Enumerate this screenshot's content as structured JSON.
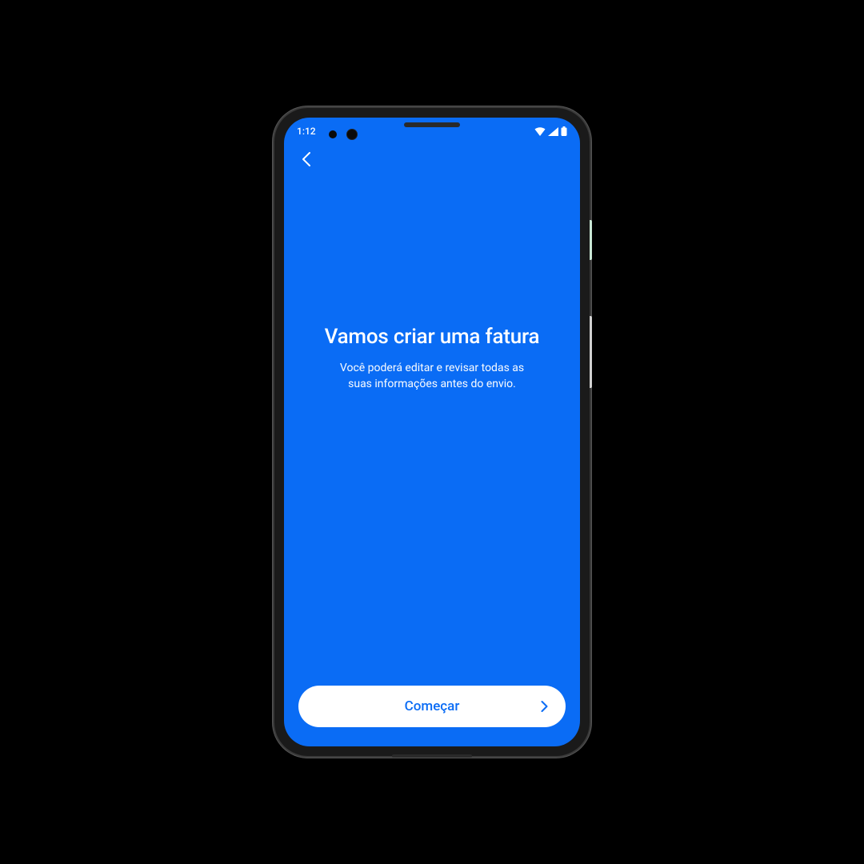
{
  "status_bar": {
    "time": "1:12"
  },
  "content": {
    "headline": "Vamos criar uma fatura",
    "subtext": "Você poderá editar e revisar todas as suas informações antes do envio."
  },
  "actions": {
    "start_label": "Começar"
  }
}
